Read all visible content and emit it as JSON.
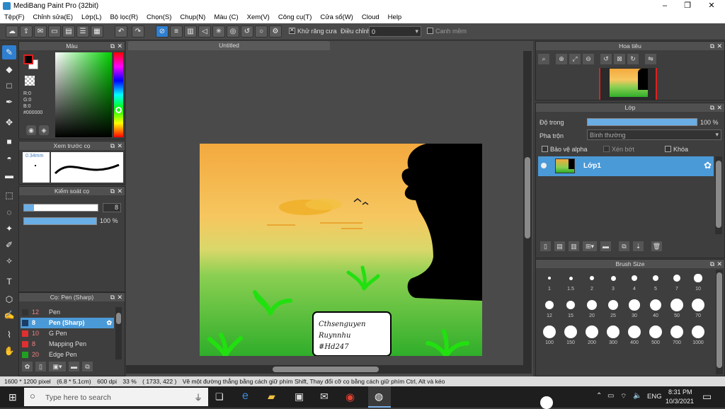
{
  "window": {
    "title": "MediBang Paint Pro (32bit)",
    "minimize": "–",
    "maximize": "❐",
    "close": "✕"
  },
  "menu": [
    "Tệp(F)",
    "Chỉnh sửa(E)",
    "Lớp(L)",
    "Bộ lọc(R)",
    "Chọn(S)",
    "Chụp(N)",
    "Màu (C)",
    "Xem(V)",
    "Công cụ(T)",
    "Cửa sổ(W)",
    "Cloud",
    "Help"
  ],
  "toolbar": {
    "antialias_label": "Khử răng cưa",
    "adjust_label": "Điều chỉnh",
    "adjust_value": "0",
    "snap_label": "Canh mềm"
  },
  "color_panel": {
    "title": "Màu",
    "r": "R:0",
    "g": "G:0",
    "b": "B:0",
    "hex": "#000000",
    "fg_color": "#000000",
    "bg_color": "#ffffff"
  },
  "brush_preview": {
    "title": "Xem trước cọ",
    "size_label": "0.34mm"
  },
  "brush_control": {
    "title": "Kiểm soát cọ",
    "size_value": "8",
    "opacity_value": "100 %",
    "opacity": 1.0,
    "size_fraction": 0.13
  },
  "brush_list": {
    "title": "Cọ: Pen (Sharp)",
    "items": [
      {
        "size": "12",
        "name": "Pen",
        "color": "#333333",
        "selected": false
      },
      {
        "size": "8",
        "name": "Pen (Sharp)",
        "color": "#1a3c66",
        "selected": true
      },
      {
        "size": "10",
        "name": "G Pen",
        "color": "#e03030",
        "selected": false
      },
      {
        "size": "8",
        "name": "Mapping Pen",
        "color": "#e03030",
        "selected": false
      },
      {
        "size": "20",
        "name": "Edge Pen",
        "color": "#20a020",
        "selected": false
      }
    ]
  },
  "document": {
    "tab": "Untitled",
    "note_lines": [
      "Cthsenguyen",
      "Ruynnhu",
      "#Hd247"
    ]
  },
  "navigator": {
    "title": "Hoa tiêu"
  },
  "layer_panel": {
    "title": "Lớp",
    "opacity_label": "Độ trong",
    "opacity_value": "100 %",
    "opacity": 1.0,
    "blend_label": "Pha trộn",
    "blend_value": "Bình thường",
    "protect_alpha": "Bảo vệ alpha",
    "clipping": "Xén bớt",
    "lock": "Khóa",
    "layer_name": "Lớp1"
  },
  "brush_size": {
    "title": "Brush Size",
    "rows": [
      [
        "1",
        "1.5",
        "2",
        "3",
        "4",
        "5",
        "7",
        "10"
      ],
      [
        "12",
        "15",
        "20",
        "25",
        "30",
        "40",
        "50",
        "70"
      ],
      [
        "100",
        "150",
        "200",
        "300",
        "400",
        "500",
        "700",
        "1000"
      ]
    ]
  },
  "status": {
    "dimensions": "1600 * 1200 pixel",
    "physical": "(6.8 * 5.1cm)",
    "dpi": "600 dpi",
    "zoom": "33 %",
    "coords": "( 1733, 422 )",
    "hint": "Vẽ một đường thẳng bằng cách giữ phím Shift, Thay đổi cỡ cọ bằng cách giữ phím Ctrl, Alt và kéo"
  },
  "taskbar": {
    "search_placeholder": "Type here to search",
    "language": "ENG",
    "time": "8:31 PM",
    "date": "10/3/2021"
  }
}
